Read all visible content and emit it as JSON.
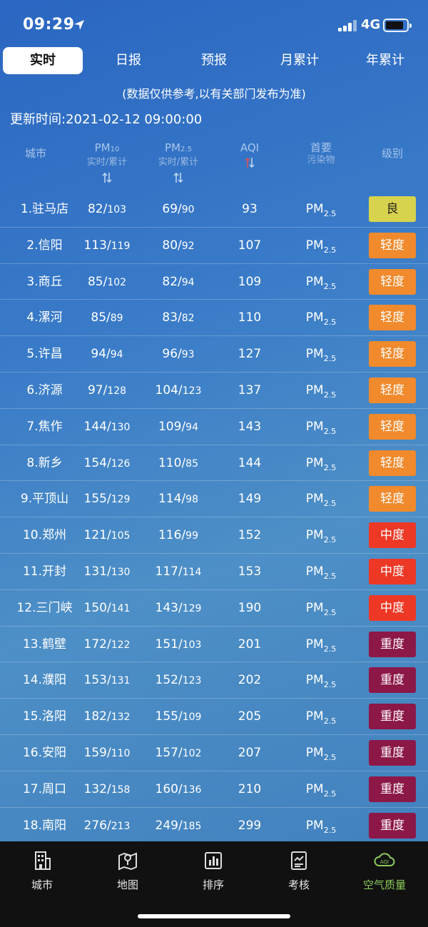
{
  "status": {
    "time": "09:29",
    "network": "4G"
  },
  "tabs": [
    {
      "label": "实时",
      "active": true
    },
    {
      "label": "日报",
      "active": false
    },
    {
      "label": "预报",
      "active": false
    },
    {
      "label": "月累计",
      "active": false
    },
    {
      "label": "年累计",
      "active": false
    }
  ],
  "notice": "(数据仅供参考,以有关部门发布为准)",
  "update_time": "更新时间:2021-02-12 09:00:00",
  "header": {
    "city": "城市",
    "pm10": "PM",
    "pm10_sub": "10",
    "pm25": "PM",
    "pm25_sub": "2.5",
    "pm_subtitle": "实时/累计",
    "aqi": "AQI",
    "primary": "首要",
    "primary_sub": "污染物",
    "level": "级别"
  },
  "level_colors": {
    "良": "#d7d34c",
    "轻度": "#f08a2c",
    "中度": "#ec3825",
    "重度": "#8c1848"
  },
  "rows": [
    {
      "city": "1.驻马店",
      "pm10": "82",
      "pm10_acc": "103",
      "pm25": "69",
      "pm25_acc": "90",
      "aqi": "93",
      "pol": "PM",
      "pol_sub": "2.5",
      "level": "良"
    },
    {
      "city": "2.信阳",
      "pm10": "113",
      "pm10_acc": "119",
      "pm25": "80",
      "pm25_acc": "92",
      "aqi": "107",
      "pol": "PM",
      "pol_sub": "2.5",
      "level": "轻度"
    },
    {
      "city": "3.商丘",
      "pm10": "85",
      "pm10_acc": "102",
      "pm25": "82",
      "pm25_acc": "94",
      "aqi": "109",
      "pol": "PM",
      "pol_sub": "2.5",
      "level": "轻度"
    },
    {
      "city": "4.漯河",
      "pm10": "85",
      "pm10_acc": "89",
      "pm25": "83",
      "pm25_acc": "82",
      "aqi": "110",
      "pol": "PM",
      "pol_sub": "2.5",
      "level": "轻度"
    },
    {
      "city": "5.许昌",
      "pm10": "94",
      "pm10_acc": "94",
      "pm25": "96",
      "pm25_acc": "93",
      "aqi": "127",
      "pol": "PM",
      "pol_sub": "2.5",
      "level": "轻度"
    },
    {
      "city": "6.济源",
      "pm10": "97",
      "pm10_acc": "128",
      "pm25": "104",
      "pm25_acc": "123",
      "aqi": "137",
      "pol": "PM",
      "pol_sub": "2.5",
      "level": "轻度"
    },
    {
      "city": "7.焦作",
      "pm10": "144",
      "pm10_acc": "130",
      "pm25": "109",
      "pm25_acc": "94",
      "aqi": "143",
      "pol": "PM",
      "pol_sub": "2.5",
      "level": "轻度"
    },
    {
      "city": "8.新乡",
      "pm10": "154",
      "pm10_acc": "126",
      "pm25": "110",
      "pm25_acc": "85",
      "aqi": "144",
      "pol": "PM",
      "pol_sub": "2.5",
      "level": "轻度"
    },
    {
      "city": "9.平顶山",
      "pm10": "155",
      "pm10_acc": "129",
      "pm25": "114",
      "pm25_acc": "98",
      "aqi": "149",
      "pol": "PM",
      "pol_sub": "2.5",
      "level": "轻度"
    },
    {
      "city": "10.郑州",
      "pm10": "121",
      "pm10_acc": "105",
      "pm25": "116",
      "pm25_acc": "99",
      "aqi": "152",
      "pol": "PM",
      "pol_sub": "2.5",
      "level": "中度"
    },
    {
      "city": "11.开封",
      "pm10": "131",
      "pm10_acc": "130",
      "pm25": "117",
      "pm25_acc": "114",
      "aqi": "153",
      "pol": "PM",
      "pol_sub": "2.5",
      "level": "中度"
    },
    {
      "city": "12.三门峡",
      "pm10": "150",
      "pm10_acc": "141",
      "pm25": "143",
      "pm25_acc": "129",
      "aqi": "190",
      "pol": "PM",
      "pol_sub": "2.5",
      "level": "中度"
    },
    {
      "city": "13.鹤壁",
      "pm10": "172",
      "pm10_acc": "122",
      "pm25": "151",
      "pm25_acc": "103",
      "aqi": "201",
      "pol": "PM",
      "pol_sub": "2.5",
      "level": "重度"
    },
    {
      "city": "14.濮阳",
      "pm10": "153",
      "pm10_acc": "131",
      "pm25": "152",
      "pm25_acc": "123",
      "aqi": "202",
      "pol": "PM",
      "pol_sub": "2.5",
      "level": "重度"
    },
    {
      "city": "15.洛阳",
      "pm10": "182",
      "pm10_acc": "132",
      "pm25": "155",
      "pm25_acc": "109",
      "aqi": "205",
      "pol": "PM",
      "pol_sub": "2.5",
      "level": "重度"
    },
    {
      "city": "16.安阳",
      "pm10": "159",
      "pm10_acc": "110",
      "pm25": "157",
      "pm25_acc": "102",
      "aqi": "207",
      "pol": "PM",
      "pol_sub": "2.5",
      "level": "重度"
    },
    {
      "city": "17.周口",
      "pm10": "132",
      "pm10_acc": "158",
      "pm25": "160",
      "pm25_acc": "136",
      "aqi": "210",
      "pol": "PM",
      "pol_sub": "2.5",
      "level": "重度"
    },
    {
      "city": "18.南阳",
      "pm10": "276",
      "pm10_acc": "213",
      "pm25": "249",
      "pm25_acc": "185",
      "aqi": "299",
      "pol": "PM",
      "pol_sub": "2.5",
      "level": "重度"
    }
  ],
  "bottom_nav": [
    {
      "label": "城市",
      "icon": "building-icon",
      "active": false
    },
    {
      "label": "地图",
      "icon": "map-icon",
      "active": false
    },
    {
      "label": "排序",
      "icon": "bar-chart-icon",
      "active": false
    },
    {
      "label": "考核",
      "icon": "assessment-icon",
      "active": false
    },
    {
      "label": "空气质量",
      "icon": "aqi-cloud-icon",
      "active": true
    }
  ]
}
